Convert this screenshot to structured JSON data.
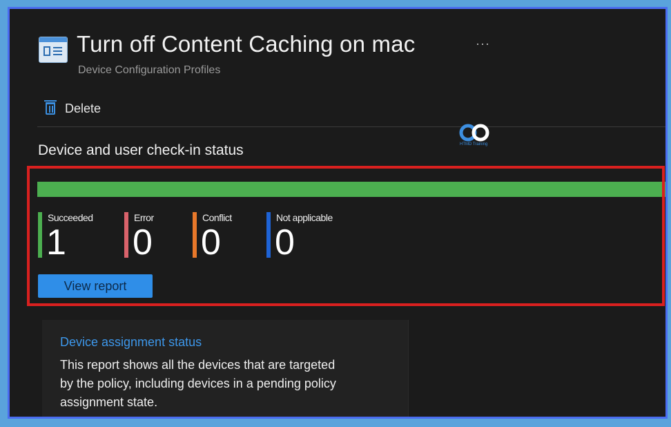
{
  "header": {
    "title": "Turn off Content Caching on mac",
    "subtitle": "Device Configuration Profiles",
    "more_label": "···"
  },
  "toolbar": {
    "delete_label": "Delete"
  },
  "watermark": {
    "text": "HTMD Training"
  },
  "checkin": {
    "title": "Device and user check-in status",
    "progress": {
      "succeeded_fraction": 1.0,
      "color": "#4caf50"
    },
    "stats": [
      {
        "label": "Succeeded",
        "value": "1",
        "color": "#4caf50"
      },
      {
        "label": "Error",
        "value": "0",
        "color": "#d9626b"
      },
      {
        "label": "Conflict",
        "value": "0",
        "color": "#e8782a"
      },
      {
        "label": "Not applicable",
        "value": "0",
        "color": "#1e63d6"
      }
    ],
    "view_report_label": "View report"
  },
  "assignment_card": {
    "title": "Device assignment status",
    "description": "This report shows all the devices that are targeted by the policy, including devices in a pending policy assignment state."
  },
  "colors": {
    "highlight_border": "#d9201f",
    "accent": "#2f8ee8",
    "background": "#1b1b1b"
  }
}
